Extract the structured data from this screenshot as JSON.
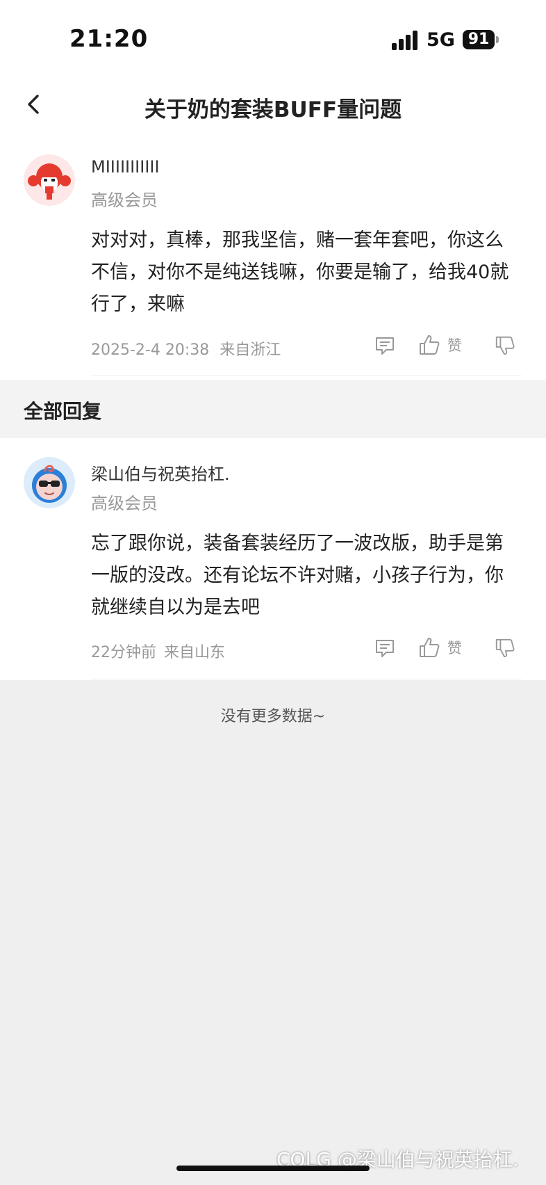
{
  "status_bar": {
    "time": "21:20",
    "network": "5G",
    "battery": "91"
  },
  "nav": {
    "title": "关于奶的套装BUFF量问题"
  },
  "post": {
    "author": "MIIIIIIIIIII",
    "rank": "高级会员",
    "content": "对对对，真棒，那我坚信，赌一套年套吧，你这么不信，对你不是纯送钱嘛，你要是输了，给我40就行了，来嘛",
    "time": "2025-2-4 20:38",
    "location": "来自浙江",
    "like_label": "赞"
  },
  "section": {
    "title": "全部回复"
  },
  "reply": {
    "author": "梁山伯与祝英抬杠.",
    "rank": "高级会员",
    "content": "忘了跟你说，装备套装经历了一波改版，助手是第一版的没改。还有论坛不许对赌，小孩子行为，你就继续自以为是去吧",
    "time": "22分钟前",
    "location": "来自山东",
    "like_label": "赞"
  },
  "footer": {
    "no_more": "没有更多数据~"
  },
  "watermark": "COLG @梁山伯与祝英抬杠.",
  "colors": {
    "background": "#efefef",
    "card": "#ffffff",
    "muted_text": "#999999",
    "avatar_red": "#e53a2f",
    "avatar_blue": "#2b7fd8"
  }
}
